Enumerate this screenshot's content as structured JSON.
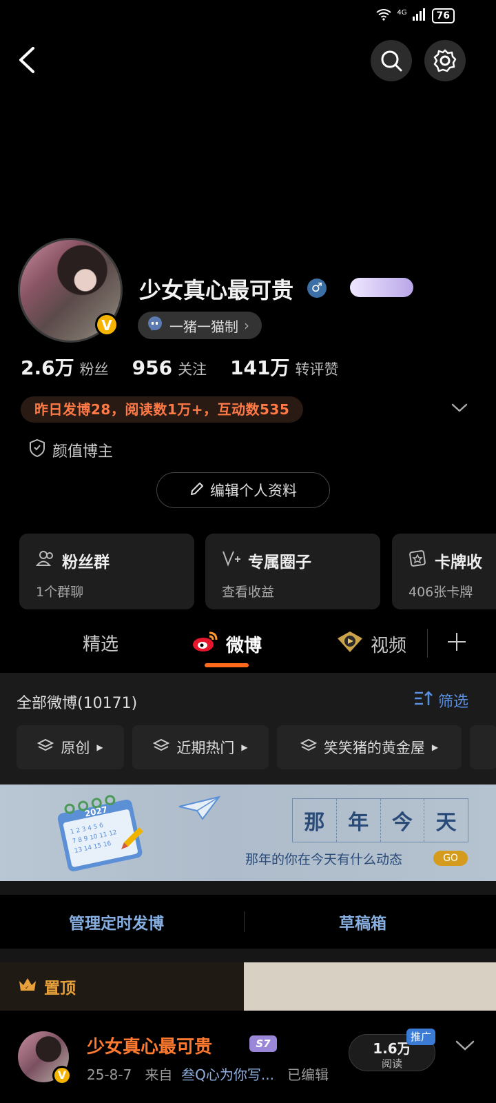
{
  "status_bar": {
    "network": "4G",
    "battery": "76"
  },
  "profile": {
    "name": "少女真心最可贵",
    "gender_symbol": "♂",
    "verified_mark": "V",
    "chip_label": "一猪一猫制",
    "stats": [
      {
        "value": "2.6万",
        "label": "粉丝"
      },
      {
        "value": "956",
        "label": "关注"
      },
      {
        "value": "141万",
        "label": "转评赞"
      }
    ],
    "notice": "昨日发博28，阅读数1万+，互动数535",
    "tag": "颜值博主",
    "edit_label": "编辑个人资料"
  },
  "cards": [
    {
      "title": "粉丝群",
      "sub": "1个群聊"
    },
    {
      "title": "专属圈子",
      "sub": "查看收益"
    },
    {
      "title": "卡牌收",
      "sub": "406张卡牌"
    }
  ],
  "tabs": [
    {
      "label": "精选"
    },
    {
      "label": "微博"
    },
    {
      "label": "视频"
    }
  ],
  "feed": {
    "title": "全部微博(10171)",
    "filter_label": "筛选",
    "pills": [
      "原创",
      "近期热门",
      "笑笑猪的黄金屋"
    ]
  },
  "banner": {
    "chars": [
      "那",
      "年",
      "今",
      "天"
    ],
    "sub": "那年的你在今天有什么动态",
    "go": "GO",
    "calendar_year": "2027"
  },
  "actions": {
    "scheduled": "管理定时发博",
    "drafts": "草稿箱"
  },
  "pinned_label": "置顶",
  "post": {
    "author": "少女真心最可贵",
    "level_badge": "S7",
    "date": "25-8-7",
    "from_label": "来自",
    "source": "叁Q心为你写...",
    "edited": "已编辑",
    "reads": "1.6万",
    "reads_label": "阅读",
    "promo": "推广"
  },
  "colors": {
    "accent_orange": "#ff6a1a",
    "link_blue": "#5a8fe0",
    "pin_gold": "#e8a13a"
  }
}
